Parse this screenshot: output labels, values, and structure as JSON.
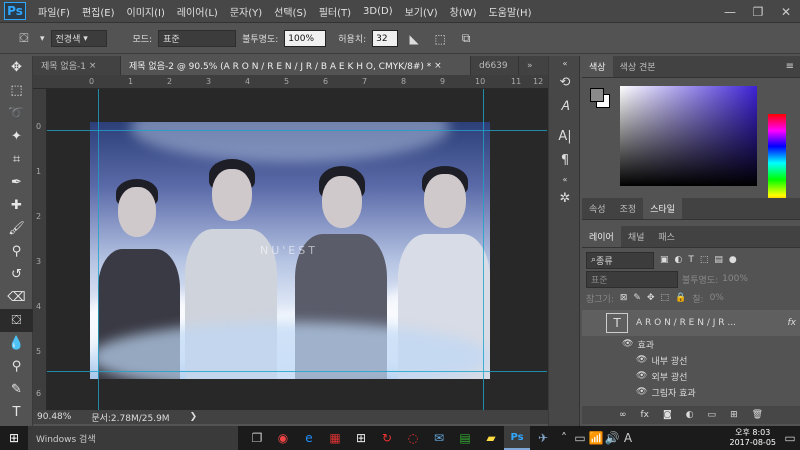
{
  "app": {
    "logo": "Ps"
  },
  "menu": [
    "파일(F)",
    "편집(E)",
    "이미지(I)",
    "레이어(L)",
    "문자(Y)",
    "선택(S)",
    "필터(T)",
    "3D(D)",
    "보기(V)",
    "창(W)",
    "도움말(H)"
  ],
  "options": {
    "tool_preset": "전경색",
    "mode_label": "모드:",
    "mode_value": "표준",
    "opacity_label": "불투명도:",
    "opacity_value": "100%",
    "tolerance_label": "허용치:",
    "tolerance_value": "32"
  },
  "doc_tabs": [
    {
      "label": "제목 없음-1"
    },
    {
      "label": "제목 없음-2 @ 90.5% (A R O N / R E N / J R / B A E K H O, CMYK/8#) *"
    },
    {
      "label": "d6639"
    }
  ],
  "canvas": {
    "image_text": "NU'EST"
  },
  "rulers": {
    "top": [
      "0",
      "1",
      "2",
      "3",
      "4",
      "5",
      "6",
      "7",
      "8",
      "9",
      "10",
      "11",
      "12"
    ],
    "left": [
      "0",
      "1",
      "2",
      "3",
      "4",
      "5",
      "6"
    ]
  },
  "status": {
    "zoom": "90.48%",
    "doc": "문서:2.78M/25.9M"
  },
  "panels": {
    "color_tabs": [
      "색상",
      "색상 견본"
    ],
    "props_tabs": [
      "속성",
      "조정",
      "스타일"
    ],
    "layer_tabs": [
      "레이어",
      "채널",
      "패스"
    ]
  },
  "layers": {
    "filter_kind": "종류",
    "blend_mode": "표준",
    "opacity_label": "불투명도:",
    "opacity_value": "100%",
    "lock_label": "잠그기:",
    "fill_label": "칠:",
    "fill_value": "0%",
    "layer_name": "A R O N / R E N / J R ...",
    "fx_label": "fx",
    "effects_label": "효과",
    "effects": [
      "내부 광선",
      "외부 광선",
      "그림자 효과"
    ]
  },
  "taskbar": {
    "search_placeholder": "Windows 검색",
    "time": "오후 8:03",
    "date": "2017-08-05",
    "lang": "A"
  },
  "colors": {
    "accent": "#31a8ff",
    "guide": "#1ea2c8",
    "foreground": "#8a8a8a",
    "background": "#ffffff"
  }
}
